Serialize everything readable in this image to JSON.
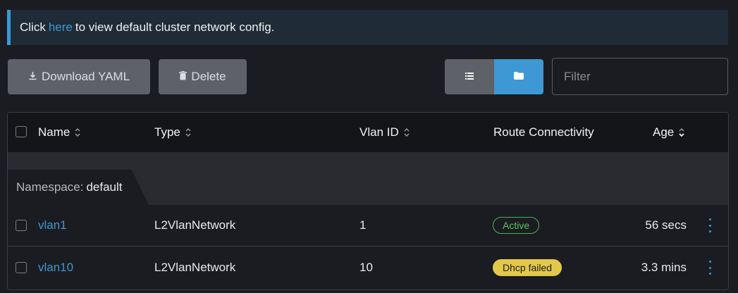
{
  "banner": {
    "prefix": "Click",
    "link": "here",
    "suffix": "to view default cluster network config."
  },
  "toolbar": {
    "download_label": "Download YAML",
    "delete_label": "Delete"
  },
  "view_toggle": {
    "list_icon": "list-icon",
    "folder_icon": "folder-icon",
    "selected": "folder"
  },
  "filter": {
    "placeholder": "Filter",
    "value": ""
  },
  "table": {
    "headers": {
      "name": "Name",
      "type": "Type",
      "vlan_id": "Vlan ID",
      "route": "Route Connectivity",
      "age": "Age"
    },
    "group": {
      "label": "Namespace:",
      "value": "default"
    },
    "rows": [
      {
        "name": "vlan1",
        "type": "L2VlanNetwork",
        "vlan_id": "1",
        "route": "Active",
        "age": "56 secs"
      },
      {
        "name": "vlan10",
        "type": "L2VlanNetwork",
        "vlan_id": "10",
        "route": "Dhcp failed",
        "age": "3.3 mins"
      }
    ]
  },
  "colors": {
    "accent": "#3d98d3",
    "active": "#5cc15f",
    "warning": "#e4c84a"
  }
}
